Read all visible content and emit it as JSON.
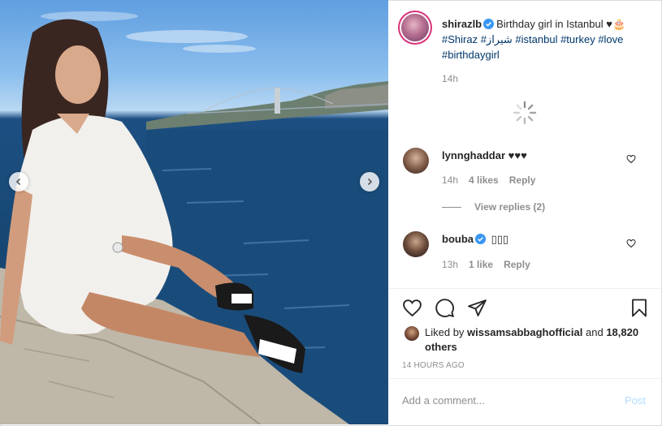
{
  "post": {
    "username": "shirazlb",
    "caption_text": "Birthday girl in Istanbul ♥🎂",
    "hashtags": "#Shiraz #شيراز #istanbul #turkey #love #birthdaygirl",
    "caption_time": "14h"
  },
  "comments": [
    {
      "username": "lynnghaddar",
      "text": "♥♥♥",
      "time": "14h",
      "likes": "4 likes",
      "reply_label": "Reply",
      "view_replies": "View replies (2)"
    },
    {
      "username": "bouba",
      "text": "▯▯▯",
      "time": "13h",
      "likes": "1 like",
      "reply_label": "Reply"
    }
  ],
  "likes": {
    "prefix": "Liked by",
    "user": "wissamsabbaghofficial",
    "joiner": "and",
    "others": "18,820 others"
  },
  "post_time": "14 HOURS AGO",
  "comment_box": {
    "placeholder": "Add a comment...",
    "post_label": "Post"
  },
  "colors": {
    "verified": "#3897f0",
    "hashtag": "#00376b",
    "muted": "#8e8e8e",
    "post_disabled": "#b3dbff"
  },
  "icons": [
    "chevron-left-icon",
    "chevron-right-icon",
    "heart-icon",
    "comment-icon",
    "share-icon",
    "bookmark-icon",
    "loading-spinner-icon",
    "verified-badge-icon"
  ]
}
